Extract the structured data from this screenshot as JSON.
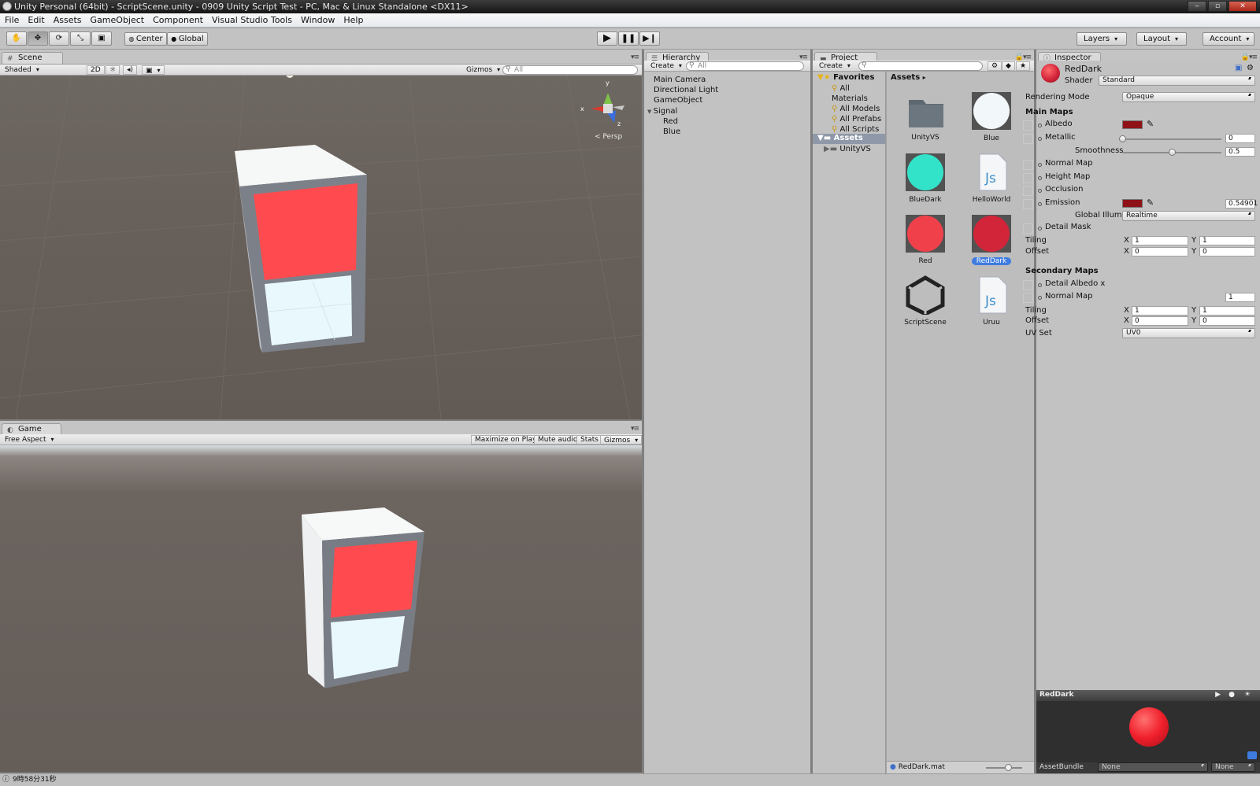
{
  "window": {
    "title": "Unity Personal (64bit) - ScriptScene.unity - 0909 Unity Script Test - PC, Mac & Linux Standalone <DX11>"
  },
  "menu": [
    "File",
    "Edit",
    "Assets",
    "GameObject",
    "Component",
    "Visual Studio Tools",
    "Window",
    "Help"
  ],
  "toolbar": {
    "pivot": "Center",
    "space": "Global",
    "layers": "Layers",
    "layout": "Layout",
    "account": "Account"
  },
  "scene": {
    "tab": "Scene",
    "shading": "Shaded",
    "mode2d": "2D",
    "gizmos": "Gizmos",
    "search_placeholder": "All",
    "persp": "Persp",
    "axes": {
      "x": "x",
      "y": "y",
      "z": "z"
    }
  },
  "game": {
    "tab": "Game",
    "aspect": "Free Aspect",
    "maximize": "Maximize on Play",
    "mute": "Mute audio",
    "stats": "Stats",
    "gizmos": "Gizmos"
  },
  "hierarchy": {
    "tab": "Hierarchy",
    "create": "Create",
    "search_placeholder": "All",
    "items": [
      "Main Camera",
      "Directional Light",
      "GameObject",
      "Signal",
      "Red",
      "Blue"
    ]
  },
  "project": {
    "tab": "Project",
    "create": "Create",
    "favorites": "Favorites",
    "favorite_items": [
      "All Materials",
      "All Models",
      "All Prefabs",
      "All Scripts"
    ],
    "assets_root": "Assets",
    "folders": [
      "UnityVS"
    ],
    "breadcrumb": "Assets",
    "assets": [
      {
        "name": "UnityVS",
        "icon": "folder-icon"
      },
      {
        "name": "Blue",
        "icon": "material-sphere",
        "color": "#f2f7f9"
      },
      {
        "name": "BlueDark",
        "icon": "material-sphere",
        "color": "#33e3c9"
      },
      {
        "name": "HelloWorld",
        "icon": "js-script-icon"
      },
      {
        "name": "Red",
        "icon": "material-sphere",
        "color": "#f0414b"
      },
      {
        "name": "RedDark",
        "icon": "material-sphere",
        "color": "#d2253a"
      },
      {
        "name": "ScriptScene",
        "icon": "unity-scene-icon"
      },
      {
        "name": "Uruu",
        "icon": "js-script-icon"
      }
    ],
    "selected_file": "RedDark.mat"
  },
  "inspector": {
    "tab": "Inspector",
    "material_name": "RedDark",
    "shader_label": "Shader",
    "shader_value": "Standard",
    "rendering_mode_label": "Rendering Mode",
    "rendering_mode_value": "Opaque",
    "main_maps": "Main Maps",
    "albedo": "Albedo",
    "albedo_color": "#8e1218",
    "metallic": "Metallic",
    "metallic_value": "0",
    "metallic_level": 0,
    "smoothness": "Smoothness",
    "smoothness_value": "0.5",
    "smoothness_level": 0.5,
    "normal_map": "Normal Map",
    "height_map": "Height Map",
    "occlusion": "Occlusion",
    "emission": "Emission",
    "emission_color": "#8e1218",
    "emission_value": "0.54901",
    "global_illum": "Global Illumi",
    "global_illum_value": "Realtime",
    "detail_mask": "Detail Mask",
    "tiling": "Tiling",
    "offset": "Offset",
    "x_label": "X",
    "y_label": "Y",
    "tiling_x": "1",
    "tiling_y": "1",
    "offset_x": "0",
    "offset_y": "0",
    "secondary_maps": "Secondary Maps",
    "detail_albedo": "Detail Albedo x",
    "sec_normal_map": "Normal Map",
    "sec_normal_value": "1",
    "sec_tiling_x": "1",
    "sec_tiling_y": "1",
    "sec_offset_x": "0",
    "sec_offset_y": "0",
    "uv_set": "UV Set",
    "uv_set_value": "UV0",
    "preview_title": "RedDark",
    "assetbundle": "AssetBundle",
    "assetbundle_value": "None",
    "assetbundle_variant": "None"
  },
  "status": {
    "text": "9時58分31秒"
  },
  "colors": {
    "light_red": "#ff4d4f",
    "cabinet_white": "#f7f8f8",
    "panel_blue_white": "#e8f8fc",
    "frame_gray": "#7a7e86"
  }
}
